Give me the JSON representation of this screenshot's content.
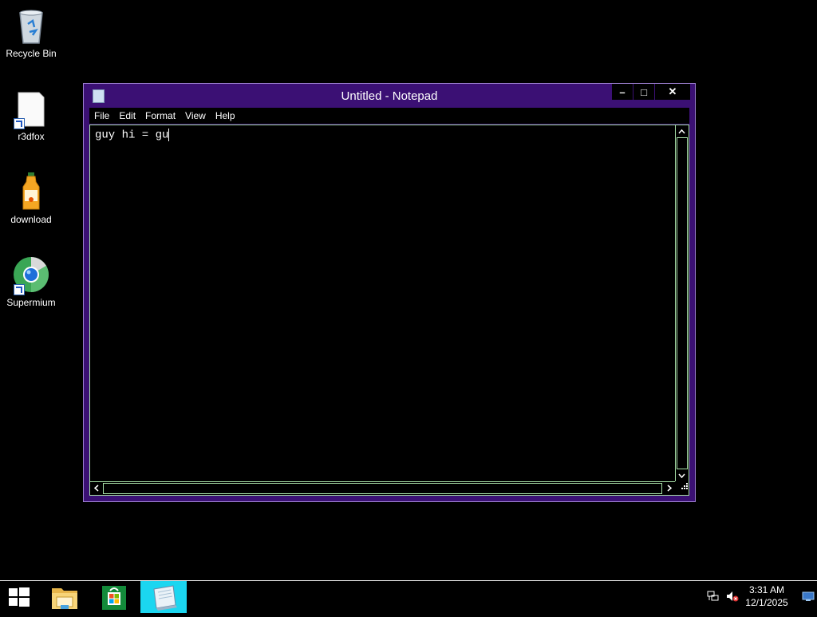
{
  "desktop": {
    "icons": [
      {
        "label": "Recycle Bin",
        "icon": "recycle-bin-icon"
      },
      {
        "label": "r3dfox",
        "icon": "file-shortcut-icon"
      },
      {
        "label": "download",
        "icon": "juice-bottle-icon"
      },
      {
        "label": "Supermium",
        "icon": "browser-icon"
      }
    ]
  },
  "window": {
    "title": "Untitled - Notepad",
    "minimize_label": "–",
    "maximize_label": "□",
    "close_label": "✕",
    "menu": [
      "File",
      "Edit",
      "Format",
      "View",
      "Help"
    ],
    "content": "guy hi = gu",
    "colors": {
      "frame": "#3b1074",
      "border": "#a8e0a8"
    }
  },
  "taskbar": {
    "buttons": [
      {
        "icon": "start-windows-icon"
      },
      {
        "icon": "file-explorer-icon"
      },
      {
        "icon": "store-icon"
      },
      {
        "icon": "notepad-icon",
        "active": true
      }
    ],
    "tray": {
      "time": "3:31 AM",
      "date": "12/1/2025",
      "icons": [
        "network-icon",
        "volume-muted-icon",
        "show-desktop-icon"
      ]
    },
    "accent": "#1bd6f0"
  }
}
